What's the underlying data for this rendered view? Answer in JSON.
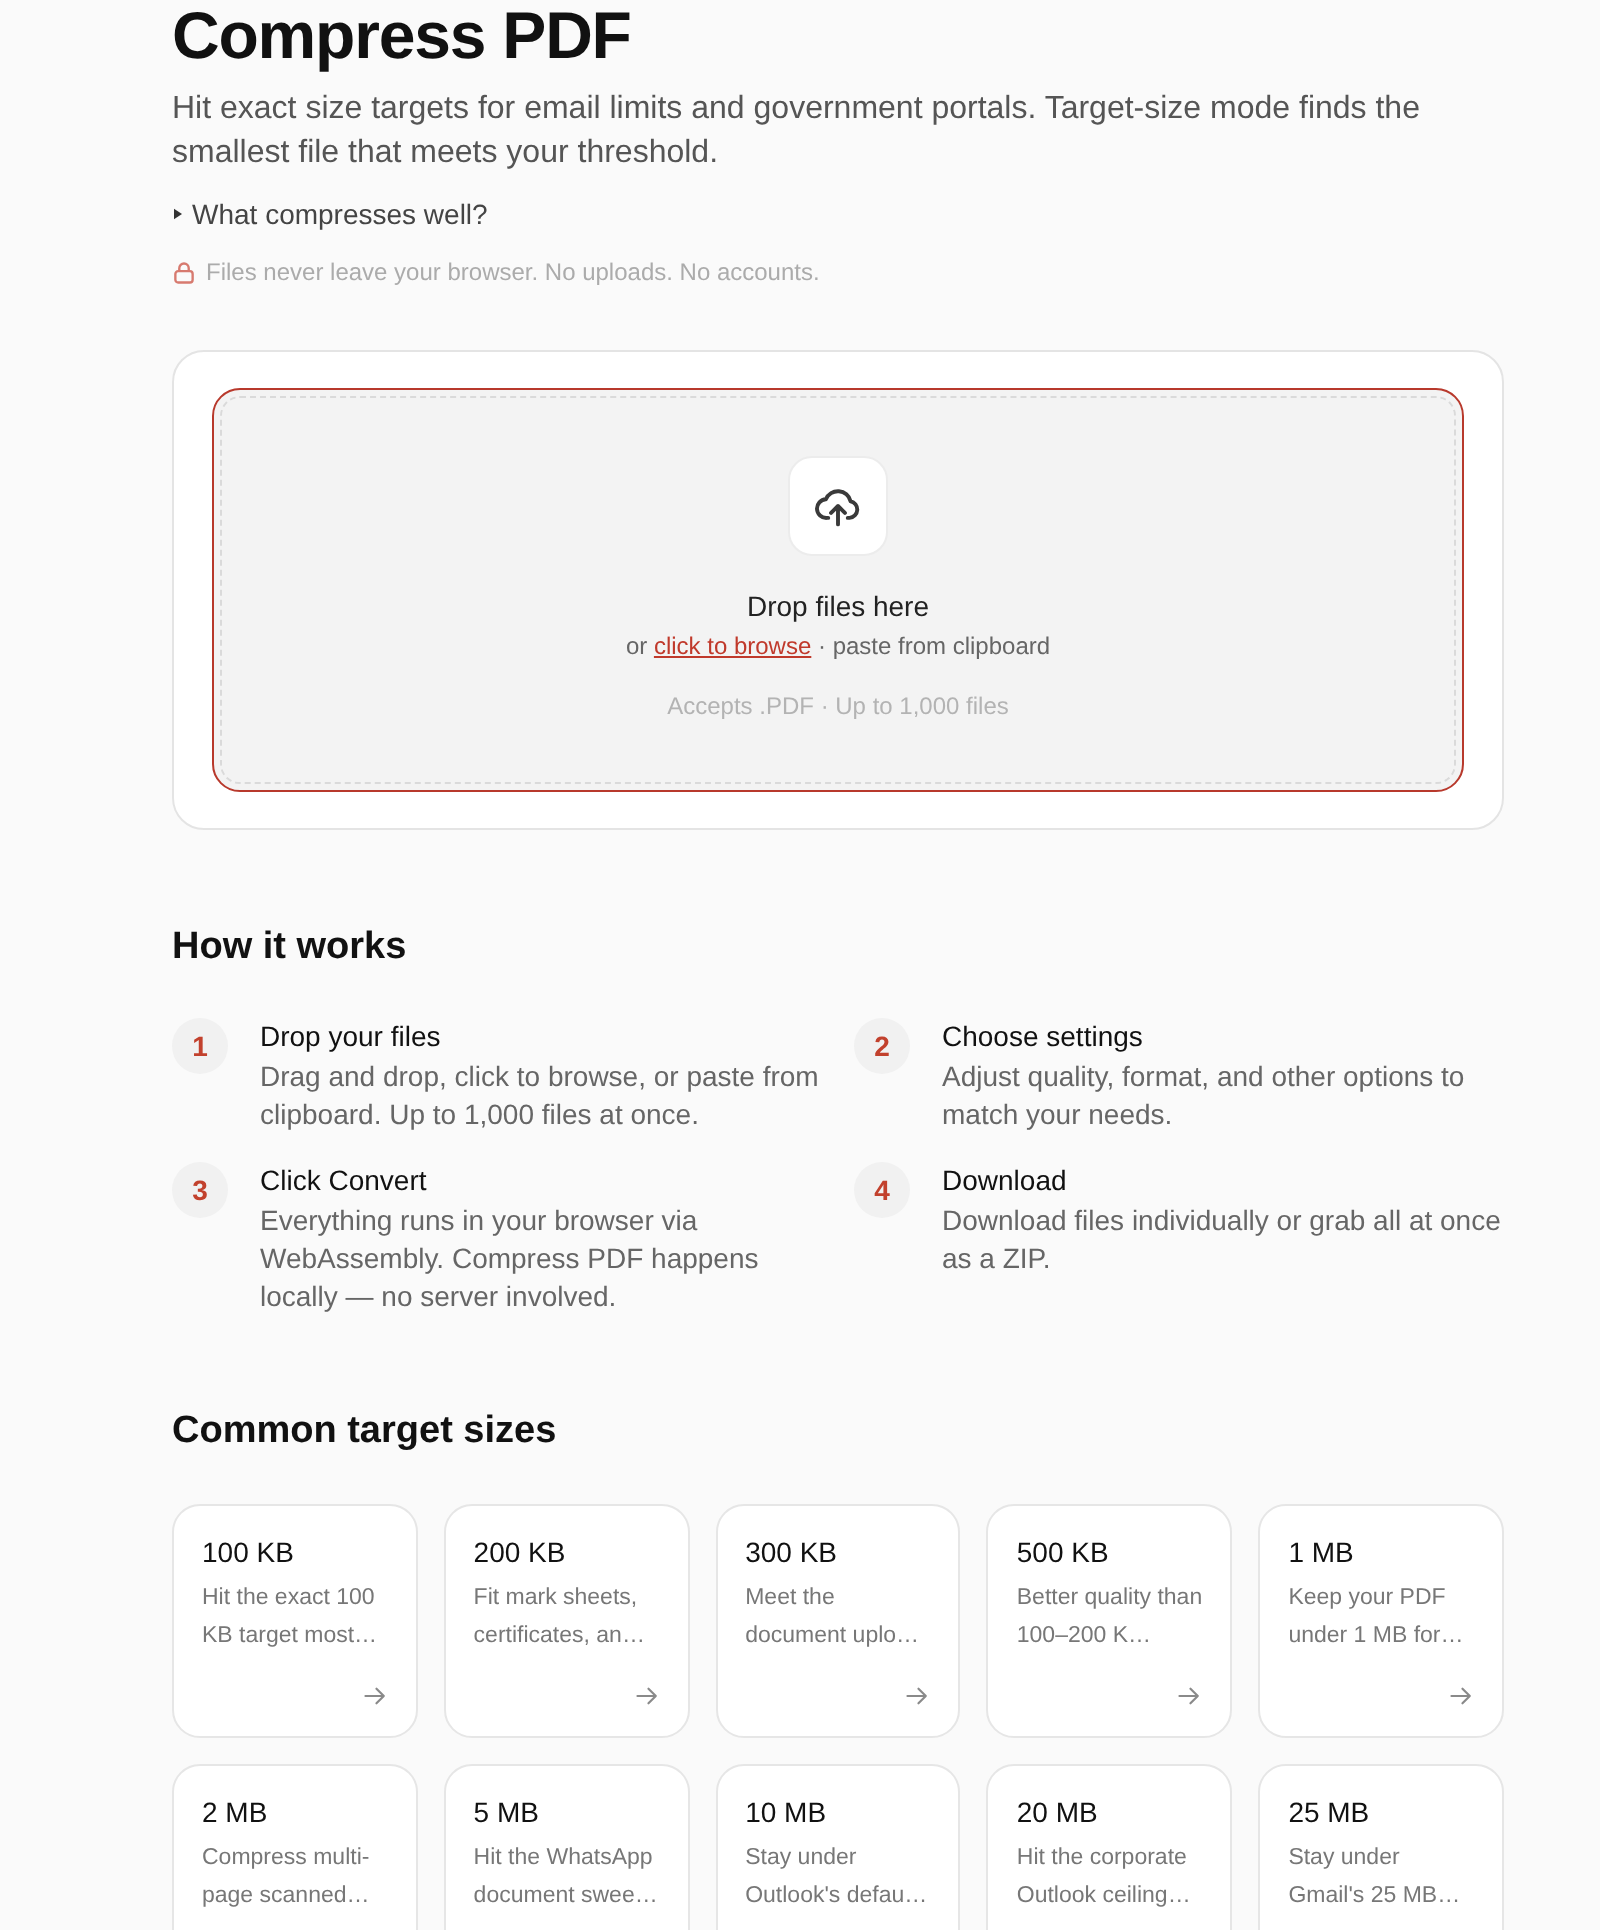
{
  "header": {
    "title": "Compress PDF",
    "subtitle": "Hit exact size targets for email limits and government portals. Target-size mode finds the smallest file that meets your threshold."
  },
  "disclosure": {
    "label": "What compresses well?",
    "expanded": false
  },
  "privacy_note": "Files never leave your browser. No uploads. No accounts.",
  "dropzone": {
    "highlighted": true,
    "heading": "Drop files here",
    "prefix": "or",
    "browse_link": "click to browse",
    "suffix": "· paste from clipboard",
    "accepts": "Accepts .PDF · Up to 1,000 files"
  },
  "how_it_works": {
    "title": "How it works",
    "steps": [
      {
        "number": "1",
        "title": "Drop your files",
        "description": "Drag and drop, click to browse, or paste from clipboard. Up to 1,000 files at once."
      },
      {
        "number": "2",
        "title": "Choose settings",
        "description": "Adjust quality, format, and other options to match your needs."
      },
      {
        "number": "3",
        "title": "Click Convert",
        "description": "Everything runs in your browser via WebAssembly. Compress PDF happens locally — no server involved."
      },
      {
        "number": "4",
        "title": "Download",
        "description": "Download files individually or grab all at once as a ZIP."
      }
    ]
  },
  "target_sizes": {
    "title": "Common target sizes",
    "cards": [
      {
        "size": "100 KB",
        "description": "Hit the exact 100 KB target most…"
      },
      {
        "size": "200 KB",
        "description": "Fit mark sheets, certificates, an…"
      },
      {
        "size": "300 KB",
        "description": "Meet the document uplo…"
      },
      {
        "size": "500 KB",
        "description": "Better quality than 100–200 K…"
      },
      {
        "size": "1 MB",
        "description": "Keep your PDF under 1 MB for…"
      },
      {
        "size": "2 MB",
        "description": "Compress multi-page scanned…"
      },
      {
        "size": "5 MB",
        "description": "Hit the WhatsApp document swee…"
      },
      {
        "size": "10 MB",
        "description": "Stay under Outlook's defau…"
      },
      {
        "size": "20 MB",
        "description": "Hit the corporate Outlook ceiling…"
      },
      {
        "size": "25 MB",
        "description": "Stay under Gmail's 25 MB…"
      }
    ]
  }
}
